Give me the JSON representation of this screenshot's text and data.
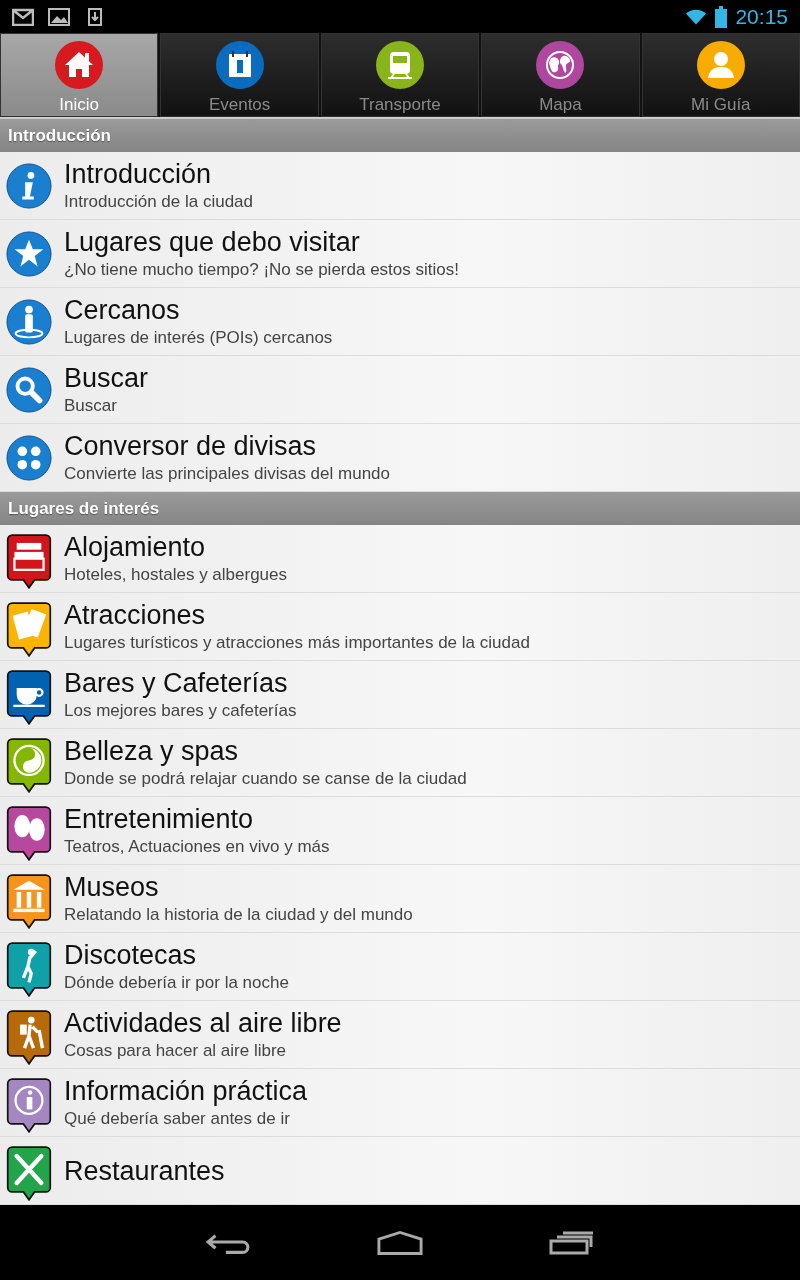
{
  "status_bar": {
    "time": "20:15"
  },
  "tabs": [
    {
      "label": "Inicio",
      "selected": true,
      "color": "#d71920"
    },
    {
      "label": "Eventos",
      "selected": false,
      "color": "#0a6cbf"
    },
    {
      "label": "Transporte",
      "selected": false,
      "color": "#8ab51a"
    },
    {
      "label": "Mapa",
      "selected": false,
      "color": "#b0479e"
    },
    {
      "label": "Mi Guía",
      "selected": false,
      "color": "#f8ac00"
    }
  ],
  "sections": [
    {
      "title": "Introducción",
      "kind": "round",
      "items": [
        {
          "title": "Introducción",
          "subtitle": "Introducción de la ciudad"
        },
        {
          "title": "Lugares que debo visitar",
          "subtitle": "¿No tiene mucho tiempo? ¡No se pierda estos sitios!"
        },
        {
          "title": "Cercanos",
          "subtitle": "Lugares de interés (POIs) cercanos"
        },
        {
          "title": "Buscar",
          "subtitle": "Buscar"
        },
        {
          "title": "Conversor de divisas",
          "subtitle": "Convierte las principales divisas del mundo"
        }
      ]
    },
    {
      "title": "Lugares de interés",
      "kind": "pin",
      "items": [
        {
          "title": "Alojamiento",
          "subtitle": "Hoteles, hostales y albergues",
          "color": "#d2151b"
        },
        {
          "title": "Atracciones",
          "subtitle": "Lugares turísticos y atracciones más importantes de la ciudad",
          "color": "#fbb400"
        },
        {
          "title": "Bares y Cafeterías",
          "subtitle": "Los mejores bares y cafeterías",
          "color": "#0062b1"
        },
        {
          "title": "Belleza y spas",
          "subtitle": "Donde se podrá relajar cuando se canse de la ciudad",
          "color": "#85b700"
        },
        {
          "title": "Entretenimiento",
          "subtitle": "Teatros, Actuaciones en vivo y más",
          "color": "#b6489e"
        },
        {
          "title": "Museos",
          "subtitle": "Relatando la historia de la ciudad y del mundo",
          "color": "#f7941d"
        },
        {
          "title": "Discotecas",
          "subtitle": "Dónde debería ir por la noche",
          "color": "#10a1a8"
        },
        {
          "title": "Actividades al aire libre",
          "subtitle": "Cosas para hacer al aire libre",
          "color": "#b66a0a"
        },
        {
          "title": "Información práctica",
          "subtitle": "Qué debería saber antes de ir",
          "color": "#a487c1"
        },
        {
          "title": "Restaurantes",
          "color": "#21a44a"
        }
      ]
    }
  ]
}
